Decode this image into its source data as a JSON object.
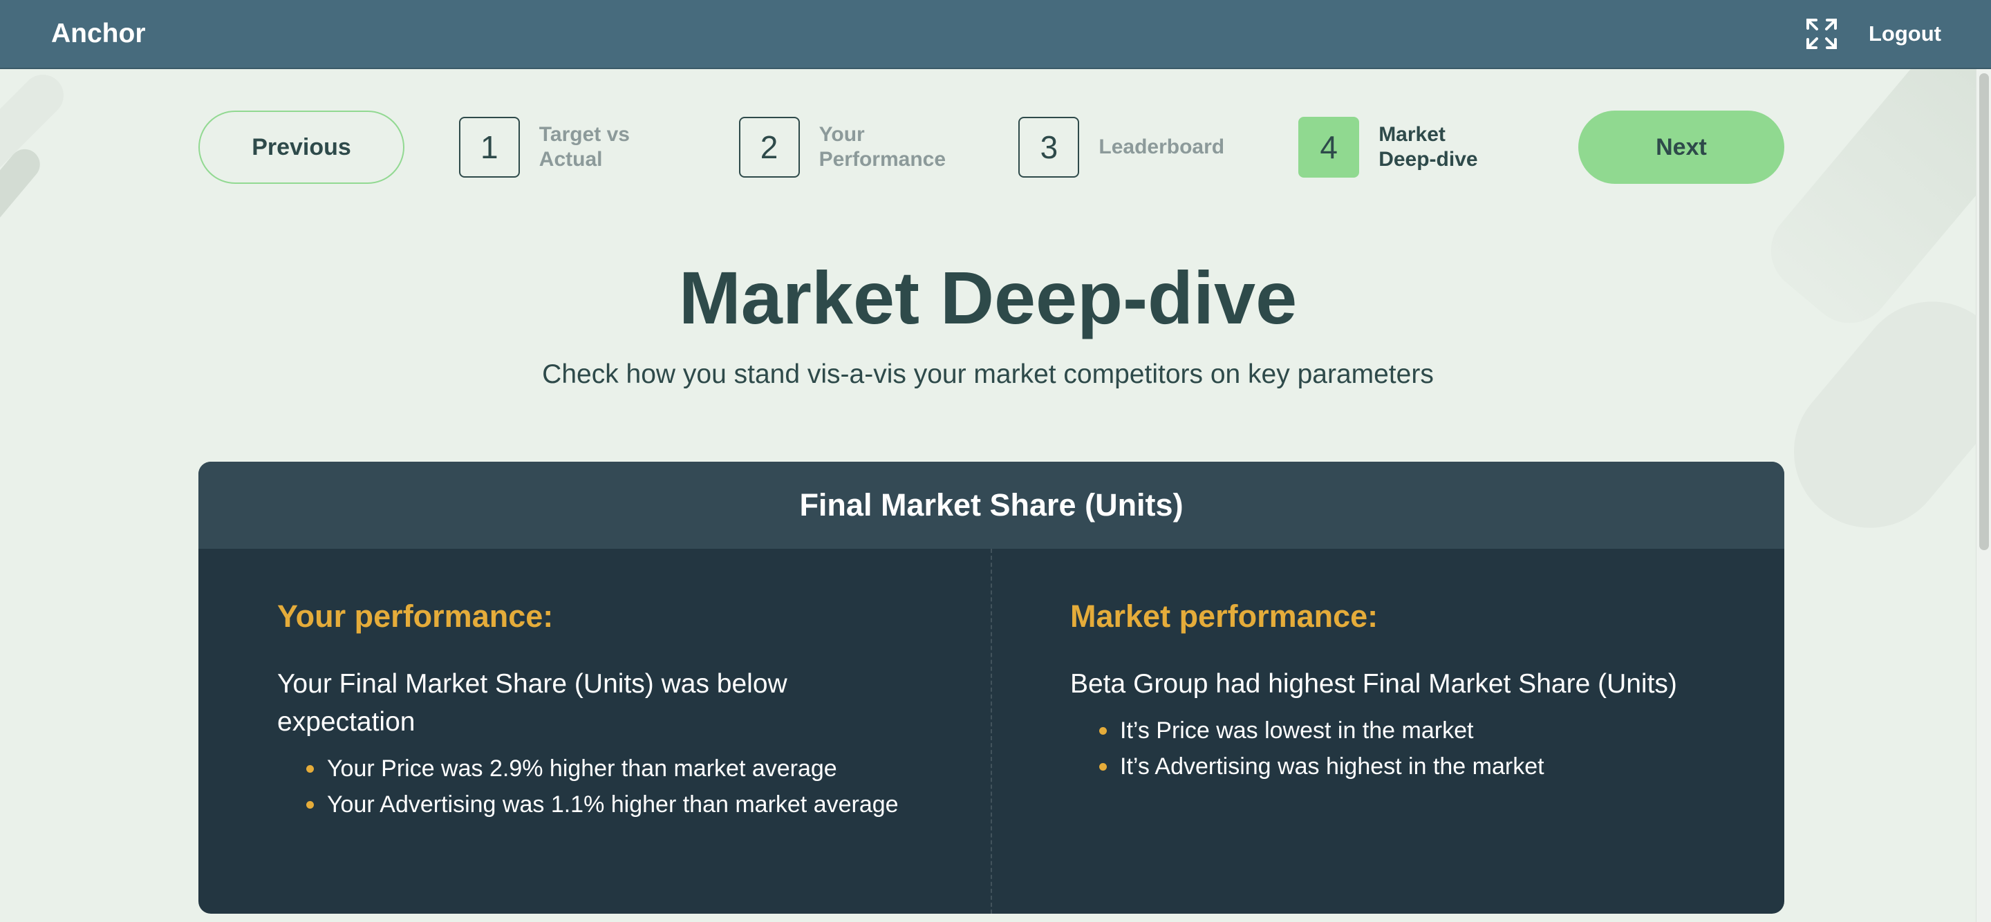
{
  "header": {
    "brand": "Anchor",
    "expand_icon": "fullscreen-icon",
    "logout_label": "Logout"
  },
  "stepper": {
    "previous_label": "Previous",
    "next_label": "Next",
    "steps": [
      {
        "number": "1",
        "label_line1": "Target vs",
        "label_line2": "Actual",
        "active": false
      },
      {
        "number": "2",
        "label_line1": "Your",
        "label_line2": "Performance",
        "active": false
      },
      {
        "number": "3",
        "label_line1": "Leaderboard",
        "label_line2": "",
        "active": false
      },
      {
        "number": "4",
        "label_line1": "Market",
        "label_line2": "Deep-dive",
        "active": true
      }
    ]
  },
  "page": {
    "title": "Market Deep-dive",
    "subtitle": "Check how you stand vis-a-vis your market competitors on key parameters"
  },
  "card": {
    "title": "Final Market Share (Units)",
    "left": {
      "heading": "Your performance:",
      "summary": "Your Final Market Share (Units) was below expectation",
      "bullets": [
        "Your Price was 2.9% higher than market average",
        "Your Advertising was 1.1% higher than market average"
      ]
    },
    "right": {
      "heading": "Market performance:",
      "summary": "Beta Group had highest Final Market Share (Units)",
      "bullets": [
        "It’s Price was lowest in the market",
        "It’s Advertising was highest in the market"
      ]
    }
  },
  "colors": {
    "header_bg": "#476b7d",
    "page_bg": "#eaf1ea",
    "accent_green": "#90d990",
    "card_bg": "#233641",
    "card_header_bg": "#344a55",
    "heading_orange": "#e5ac3a"
  }
}
